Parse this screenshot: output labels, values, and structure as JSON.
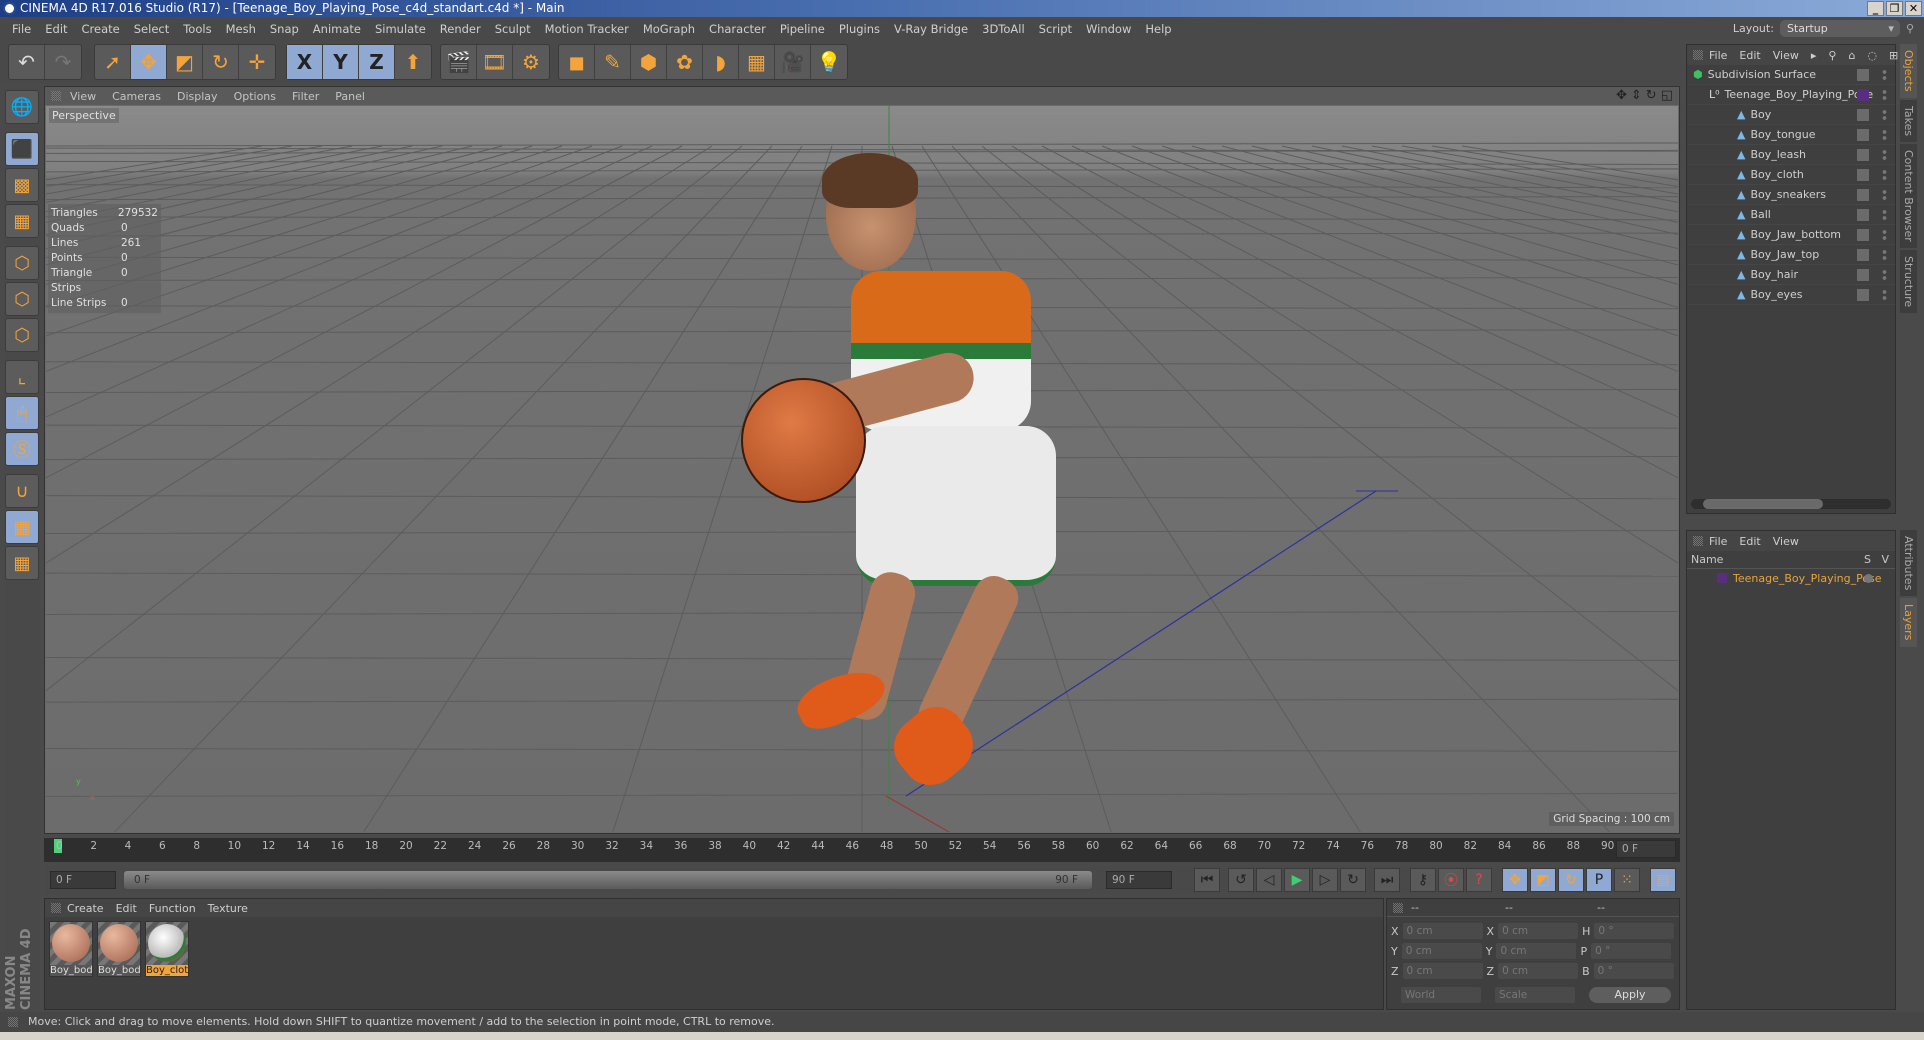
{
  "window": {
    "title": "CINEMA 4D R17.016 Studio (R17) - [Teenage_Boy_Playing_Pose_c4d_standart.c4d *] - Main",
    "buttons": [
      "_",
      "❐",
      "✕"
    ]
  },
  "menu": [
    "File",
    "Edit",
    "Create",
    "Select",
    "Tools",
    "Mesh",
    "Snap",
    "Animate",
    "Simulate",
    "Render",
    "Sculpt",
    "Motion Tracker",
    "MoGraph",
    "Character",
    "Pipeline",
    "Plugins",
    "V-Ray Bridge",
    "3DToAll",
    "Script",
    "Window",
    "Help"
  ],
  "layout": {
    "label": "Layout:",
    "value": "Startup"
  },
  "toolbar": {
    "undo": "↶",
    "redo": "↷",
    "tools": [
      {
        "name": "select-live",
        "glyph": "➚"
      },
      {
        "name": "move",
        "glyph": "✥"
      },
      {
        "name": "scale",
        "glyph": "◩"
      },
      {
        "name": "rotate",
        "glyph": "↻"
      },
      {
        "name": "recent",
        "glyph": "✛"
      }
    ],
    "axes": [
      {
        "name": "x-axis",
        "glyph": "X"
      },
      {
        "name": "y-axis",
        "glyph": "Y"
      },
      {
        "name": "z-axis",
        "glyph": "Z"
      },
      {
        "name": "coord-system",
        "glyph": "⬆"
      }
    ],
    "render": [
      {
        "name": "render-view",
        "glyph": "🎬"
      },
      {
        "name": "render-picture-viewer",
        "glyph": "🎞"
      },
      {
        "name": "render-settings",
        "glyph": "⚙"
      }
    ],
    "objects": [
      {
        "name": "cube",
        "glyph": "◼"
      },
      {
        "name": "pen",
        "glyph": "✎"
      },
      {
        "name": "subdivision",
        "glyph": "⬢"
      },
      {
        "name": "cloner",
        "glyph": "✿"
      },
      {
        "name": "deformer",
        "glyph": "◗"
      },
      {
        "name": "floor",
        "glyph": "▦"
      },
      {
        "name": "camera",
        "glyph": "🎥"
      },
      {
        "name": "light",
        "glyph": "💡"
      }
    ]
  },
  "leftbar": [
    {
      "name": "make-editable",
      "glyph": "🌐"
    },
    {
      "name": "model-mode",
      "glyph": "⬛"
    },
    {
      "name": "texture-mode",
      "glyph": "▩"
    },
    {
      "name": "workplane-mode",
      "glyph": "▦"
    },
    {
      "name": "points-mode",
      "glyph": "⬡"
    },
    {
      "name": "edges-mode",
      "glyph": "⬡"
    },
    {
      "name": "polygons-mode",
      "glyph": "⬡"
    },
    {
      "name": "axis-mode",
      "glyph": "⌞"
    },
    {
      "name": "tweak-mode",
      "glyph": "🖱"
    },
    {
      "name": "solo",
      "glyph": "Ⓢ"
    },
    {
      "name": "snap",
      "glyph": "∪"
    },
    {
      "name": "workplane-lock",
      "glyph": "▦"
    },
    {
      "name": "workplane-align",
      "glyph": "▦"
    }
  ],
  "viewport": {
    "menu": [
      "View",
      "Cameras",
      "Display",
      "Options",
      "Filter",
      "Panel"
    ],
    "camera": "Perspective",
    "stats": [
      {
        "k": "Triangles",
        "v": "279532"
      },
      {
        "k": "Quads",
        "v": "0"
      },
      {
        "k": "Lines",
        "v": "261"
      },
      {
        "k": "Points",
        "v": "0"
      },
      {
        "k": "Triangle Strips",
        "v": "0"
      },
      {
        "k": "Line Strips",
        "v": "0"
      }
    ],
    "grid_spacing": "Grid Spacing : 100 cm"
  },
  "objects_panel": {
    "menu": [
      "File",
      "Edit",
      "View"
    ],
    "items": [
      {
        "name": "Subdivision Surface",
        "level": 0,
        "type": "subdivision"
      },
      {
        "name": "Teenage_Boy_Playing_Pose",
        "level": 1,
        "type": "null",
        "tag": "purple"
      },
      {
        "name": "Boy",
        "level": 2,
        "type": "polygon"
      },
      {
        "name": "Boy_tongue",
        "level": 2,
        "type": "polygon"
      },
      {
        "name": "Boy_leash",
        "level": 2,
        "type": "polygon"
      },
      {
        "name": "Boy_cloth",
        "level": 2,
        "type": "polygon"
      },
      {
        "name": "Boy_sneakers",
        "level": 2,
        "type": "polygon"
      },
      {
        "name": "Ball",
        "level": 2,
        "type": "polygon"
      },
      {
        "name": "Boy_Jaw_bottom",
        "level": 2,
        "type": "polygon"
      },
      {
        "name": "Boy_Jaw_top",
        "level": 2,
        "type": "polygon"
      },
      {
        "name": "Boy_hair",
        "level": 2,
        "type": "polygon"
      },
      {
        "name": "Boy_eyes",
        "level": 2,
        "type": "polygon"
      }
    ]
  },
  "side_tabs_top": [
    "Objects",
    "Takes",
    "Content Browser",
    "Structure"
  ],
  "side_tabs_bottom": [
    "Attributes",
    "Layers"
  ],
  "layers_panel": {
    "menu": [
      "File",
      "Edit",
      "View"
    ],
    "col_name": "Name",
    "col_s": "S",
    "col_v": "V",
    "layers": [
      {
        "name": "Teenage_Boy_Playing_Pose",
        "color": "#5b2d7e"
      }
    ]
  },
  "timeline": {
    "ticks": [
      "0",
      "2",
      "4",
      "6",
      "8",
      "10",
      "12",
      "14",
      "16",
      "18",
      "20",
      "22",
      "24",
      "26",
      "28",
      "30",
      "32",
      "34",
      "36",
      "38",
      "40",
      "42",
      "44",
      "46",
      "48",
      "50",
      "52",
      "54",
      "56",
      "58",
      "60",
      "62",
      "64",
      "66",
      "68",
      "70",
      "72",
      "74",
      "76",
      "78",
      "80",
      "82",
      "84",
      "86",
      "88",
      "90"
    ],
    "current_frame": "0 F"
  },
  "playback": {
    "start": "0 F",
    "range_start": "0 F",
    "range_end": "90 F",
    "end": "90 F",
    "buttons": [
      {
        "name": "go-start",
        "glyph": "⏮"
      },
      {
        "name": "prev-key",
        "glyph": "↺"
      },
      {
        "name": "prev-frame",
        "glyph": "◁"
      },
      {
        "name": "play",
        "glyph": "▶"
      },
      {
        "name": "next-frame",
        "glyph": "▷"
      },
      {
        "name": "next-key",
        "glyph": "↻"
      },
      {
        "name": "go-end",
        "glyph": "⏭"
      }
    ],
    "record": [
      {
        "name": "keyframe-lock",
        "glyph": "⚷"
      },
      {
        "name": "record",
        "glyph": "⦿"
      },
      {
        "name": "autokey",
        "glyph": "?"
      }
    ],
    "keys": [
      {
        "name": "key-position",
        "glyph": "✥"
      },
      {
        "name": "key-scale",
        "glyph": "◩"
      },
      {
        "name": "key-rotation",
        "glyph": "↻"
      },
      {
        "name": "key-param",
        "glyph": "P"
      },
      {
        "name": "key-pla",
        "glyph": "⁙"
      },
      {
        "name": "timeline-window",
        "glyph": "▤"
      }
    ]
  },
  "material_panel": {
    "menu": [
      "Create",
      "Edit",
      "Function",
      "Texture"
    ],
    "materials": [
      {
        "label": "Boy_bod",
        "selected": false
      },
      {
        "label": "Boy_bod",
        "selected": false
      },
      {
        "label": "Boy_clot",
        "selected": true
      }
    ]
  },
  "coord_panel": {
    "headers": [
      "--",
      "--",
      "--"
    ],
    "rows": [
      {
        "a": "X",
        "av": "0 cm",
        "b": "X",
        "bv": "0 cm",
        "c": "H",
        "cv": "0 °"
      },
      {
        "a": "Y",
        "av": "0 cm",
        "b": "Y",
        "bv": "0 cm",
        "c": "P",
        "cv": "0 °"
      },
      {
        "a": "Z",
        "av": "0 cm",
        "b": "Z",
        "bv": "0 cm",
        "c": "B",
        "cv": "0 °"
      }
    ],
    "mode": "World",
    "type": "Scale",
    "apply": "Apply"
  },
  "brand": "MAXON CINEMA 4D",
  "status": "Move: Click and drag to move elements. Hold down SHIFT to quantize movement / add to the selection in point mode, CTRL to remove."
}
